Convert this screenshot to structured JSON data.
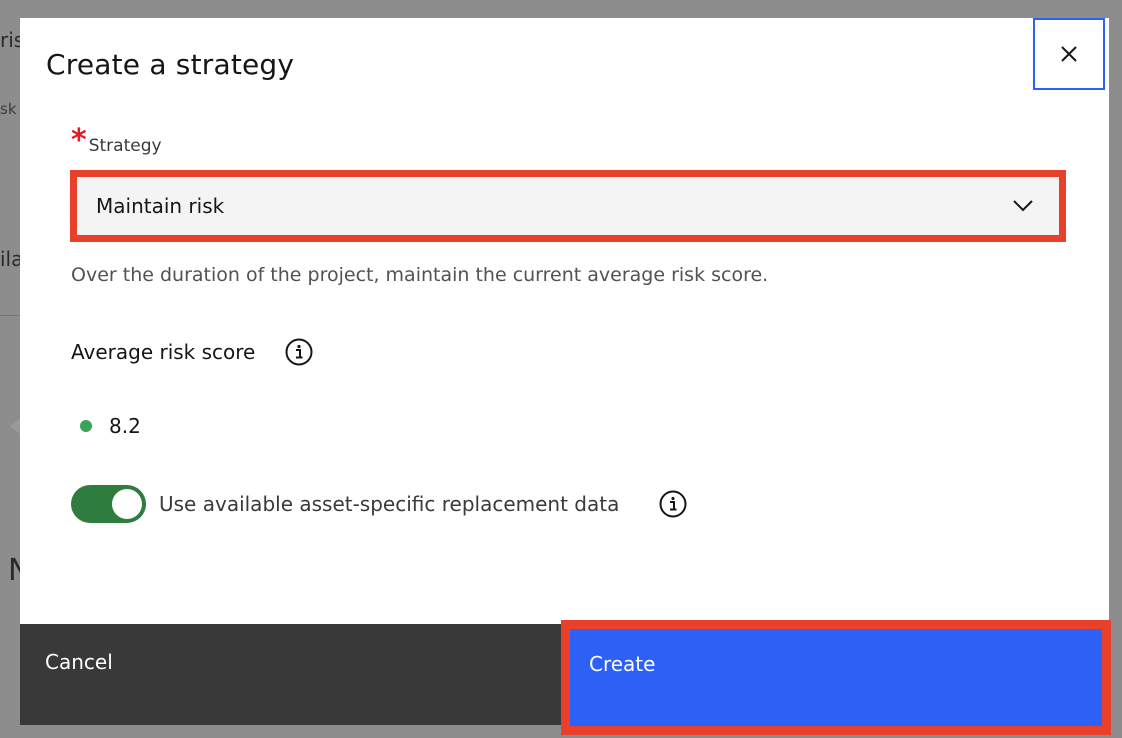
{
  "background": {
    "fragments": [
      "ris",
      "sk",
      "ila",
      "N"
    ]
  },
  "modal": {
    "title": "Create a strategy",
    "close_icon": "close-icon",
    "strategy_field": {
      "label": "Strategy",
      "required_marker": "*",
      "selected_value": "Maintain risk",
      "chevron_icon": "chevron-down-icon"
    },
    "helper_text": "Over the duration of the project, maintain the current average risk score.",
    "average_risk": {
      "label": "Average risk score",
      "info_icon": "info-icon",
      "value": "8.2",
      "status_color": "#3aa354"
    },
    "toggle": {
      "label": "Use available asset-specific replacement data",
      "on": true,
      "info_icon": "info-icon"
    },
    "footer": {
      "cancel_label": "Cancel",
      "create_label": "Create"
    }
  },
  "colors": {
    "primary": "#2d61f5",
    "highlight": "#e8402a",
    "toggle_on": "#2f7d3e",
    "required": "#da1e28"
  }
}
